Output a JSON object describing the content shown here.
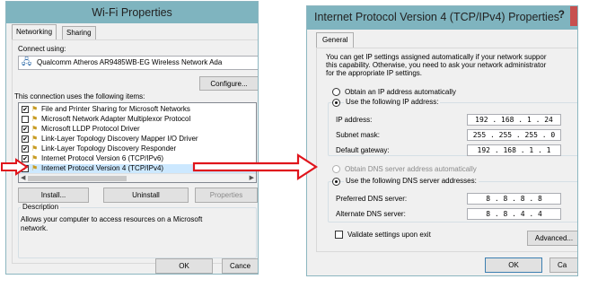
{
  "left_window": {
    "title": "Wi-Fi Properties",
    "tabs": [
      {
        "label": "Networking"
      },
      {
        "label": "Sharing"
      }
    ],
    "connect_using_label": "Connect using:",
    "adapter_name": "Qualcomm Atheros AR9485WB-EG Wireless Network Ada",
    "configure_button": "Configure...",
    "items_label": "This connection uses the following items:",
    "items": [
      {
        "checked": true,
        "label": "File and Printer Sharing for Microsoft Networks"
      },
      {
        "checked": false,
        "label": "Microsoft Network Adapter Multiplexor Protocol"
      },
      {
        "checked": true,
        "label": "Microsoft LLDP Protocol Driver"
      },
      {
        "checked": true,
        "label": "Link-Layer Topology Discovery Mapper I/O Driver"
      },
      {
        "checked": true,
        "label": "Link-Layer Topology Discovery Responder"
      },
      {
        "checked": true,
        "label": "Internet Protocol Version 6 (TCP/IPv6)"
      },
      {
        "checked": true,
        "label": "Internet Protocol Version 4 (TCP/IPv4)",
        "selected": true
      }
    ],
    "install_button": "Install...",
    "uninstall_button": "Uninstall",
    "properties_button": "Properties",
    "description_label": "Description",
    "description_text_1": "Allows your computer to access resources on a Microsoft",
    "description_text_2": "network.",
    "ok_button": "OK",
    "cancel_button": "Cance"
  },
  "right_window": {
    "title": "Internet Protocol Version 4 (TCP/IPv4) Properties",
    "help_glyph": "?",
    "tab_general": "General",
    "intro_line_1": "You can get IP settings assigned automatically if your network suppor",
    "intro_line_2": "this capability. Otherwise, you need to ask your network administrator",
    "intro_line_3": "for the appropriate IP settings.",
    "obtain_ip_auto": "Obtain an IP address automatically",
    "use_following_ip": "Use the following IP address:",
    "ip_address_label": "IP address:",
    "ip_address_value": "192 . 168 . 1 . 24",
    "subnet_mask_label": "Subnet mask:",
    "subnet_mask_value": "255 . 255 . 255 . 0",
    "default_gateway_label": "Default gateway:",
    "default_gateway_value": "192 . 168 . 1 . 1",
    "obtain_dns_auto": "Obtain DNS server address automatically",
    "use_following_dns": "Use the following DNS server addresses:",
    "preferred_dns_label": "Preferred DNS server:",
    "preferred_dns_value": "8 . 8 . 8 . 8",
    "alternate_dns_label": "Alternate DNS server:",
    "alternate_dns_value": "8 . 8 . 4 . 4",
    "validate_label": "Validate settings upon exit",
    "advanced_button": "Advanced...",
    "ok_button": "OK",
    "cancel_button": "Ca"
  },
  "colors": {
    "titlebar": "#7fb4bf",
    "window_bg": "#f0f0f0",
    "selection": "#cce8ff",
    "annotation_arrow": "#e0151c",
    "close_button": "#c7504f"
  },
  "icons": {
    "adapter": "network-adapter-icon",
    "component": "network-component-icon",
    "arrow": "red-annotation-arrow"
  }
}
